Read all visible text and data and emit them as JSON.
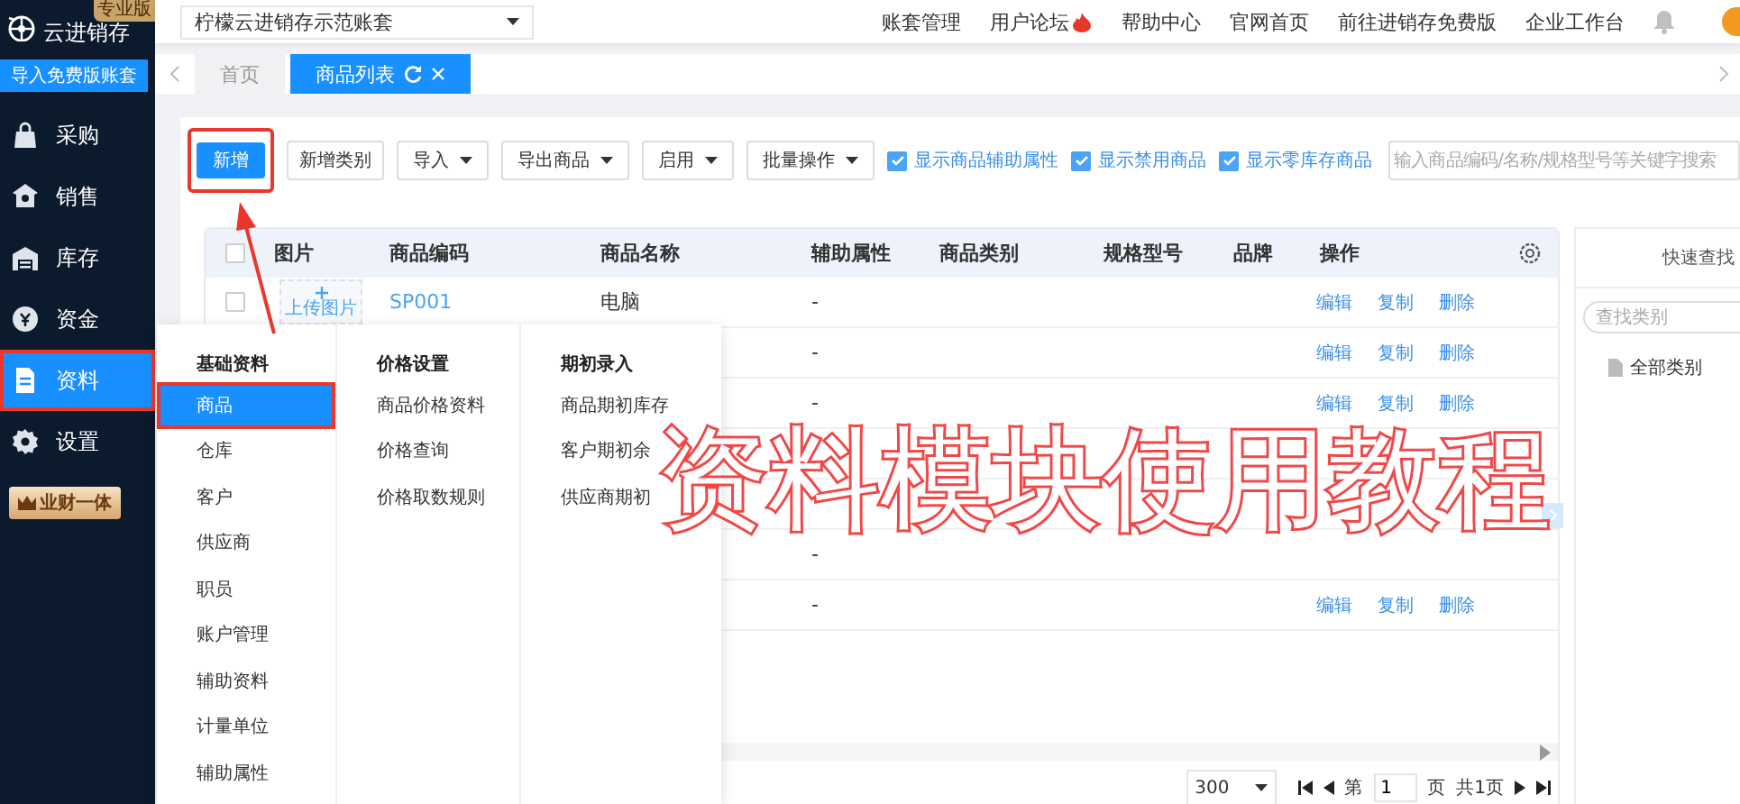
{
  "sidebar": {
    "logo": "云进销存",
    "edition_badge": "专业版",
    "import_button": "导入免费版账套",
    "items": [
      {
        "label": "采购",
        "selected": false,
        "highlighted": false
      },
      {
        "label": "销售",
        "selected": false,
        "highlighted": false
      },
      {
        "label": "库存",
        "selected": false,
        "highlighted": false
      },
      {
        "label": "资金",
        "selected": false,
        "highlighted": false
      },
      {
        "label": "资料",
        "selected": true,
        "highlighted": true
      },
      {
        "label": "设置",
        "selected": false,
        "highlighted": false
      }
    ],
    "promo_button": "业财一体"
  },
  "topbar": {
    "account_select": "柠檬云进销存示范账套",
    "links": [
      {
        "label": "账套管理",
        "hot": false
      },
      {
        "label": "用户论坛",
        "hot": true
      },
      {
        "label": "帮助中心",
        "hot": false
      },
      {
        "label": "官网首页",
        "hot": false
      },
      {
        "label": "前往进销存免费版",
        "hot": false
      },
      {
        "label": "企业工作台",
        "hot": false
      }
    ]
  },
  "tabs": [
    {
      "label": "首页",
      "selected": false
    },
    {
      "label": "商品列表",
      "selected": true
    }
  ],
  "toolbar": {
    "buttons": [
      {
        "label": "新增",
        "kind": "primary",
        "highlighted": true
      },
      {
        "label": "新增类别",
        "kind": "plain",
        "highlighted": false
      },
      {
        "label": "导入",
        "kind": "dropdown",
        "highlighted": false
      },
      {
        "label": "导出商品",
        "kind": "dropdown",
        "highlighted": false
      },
      {
        "label": "启用",
        "kind": "dropdown",
        "highlighted": false
      },
      {
        "label": "批量操作",
        "kind": "dropdown",
        "highlighted": false
      }
    ],
    "checkboxes": [
      {
        "label": "显示商品辅助属性",
        "checked": true
      },
      {
        "label": "显示禁用商品",
        "checked": true
      },
      {
        "label": "显示零库存商品",
        "checked": true
      }
    ],
    "search": {
      "placeholder": "输入商品编码/名称/规格型号等关键字搜索"
    }
  },
  "table": {
    "header_checked": false,
    "columns": [
      "图片",
      "商品编码",
      "商品名称",
      "辅助属性",
      "商品类别",
      "规格型号",
      "品牌",
      "操作"
    ],
    "rows": [
      {
        "checked": false,
        "picture": "上传图片",
        "code": "SP001",
        "name": "电脑",
        "attribute": "-",
        "actions": [
          "编辑",
          "复制",
          "删除"
        ]
      },
      {
        "attribute": "-",
        "actions": [
          "编辑",
          "复制",
          "删除"
        ]
      },
      {
        "attribute": "-",
        "actions": [
          "编辑",
          "复制",
          "删除"
        ]
      },
      {},
      {},
      {
        "attribute": "-"
      },
      {
        "attribute": "-",
        "actions": [
          "编辑",
          "复制",
          "删除"
        ]
      }
    ]
  },
  "pagination": {
    "page_size": "300",
    "page_prefix": "第",
    "page": "1",
    "page_suffix": "页",
    "total": "共1页"
  },
  "quick_find": {
    "title": "快速查找",
    "search_placeholder": "查找类别",
    "tree": [
      {
        "label": "全部类别"
      }
    ]
  },
  "data_menu": {
    "columns": [
      {
        "heading": "基础资料",
        "items": [
          {
            "label": "商品",
            "selected": true,
            "highlighted": true
          },
          {
            "label": "仓库",
            "selected": false,
            "highlighted": false
          },
          {
            "label": "客户",
            "selected": false,
            "highlighted": false
          },
          {
            "label": "供应商",
            "selected": false,
            "highlighted": false
          },
          {
            "label": "职员",
            "selected": false,
            "highlighted": false
          },
          {
            "label": "账户管理",
            "selected": false,
            "highlighted": false
          },
          {
            "label": "辅助资料",
            "selected": false,
            "highlighted": false
          },
          {
            "label": "计量单位",
            "selected": false,
            "highlighted": false
          },
          {
            "label": "辅助属性",
            "selected": false,
            "highlighted": false
          }
        ]
      },
      {
        "heading": "价格设置",
        "items": [
          {
            "label": "商品价格资料",
            "selected": false,
            "highlighted": false
          },
          {
            "label": "价格查询",
            "selected": false,
            "highlighted": false
          },
          {
            "label": "价格取数规则",
            "selected": false,
            "highlighted": false
          }
        ]
      },
      {
        "heading": "期初录入",
        "items": [
          {
            "label": "商品期初库存",
            "selected": false,
            "highlighted": false
          },
          {
            "label": "客户期初余",
            "selected": false,
            "highlighted": false
          },
          {
            "label": "供应商期初",
            "selected": false,
            "highlighted": false
          }
        ]
      }
    ]
  },
  "tutorial_caption": "资料模块使用教程"
}
